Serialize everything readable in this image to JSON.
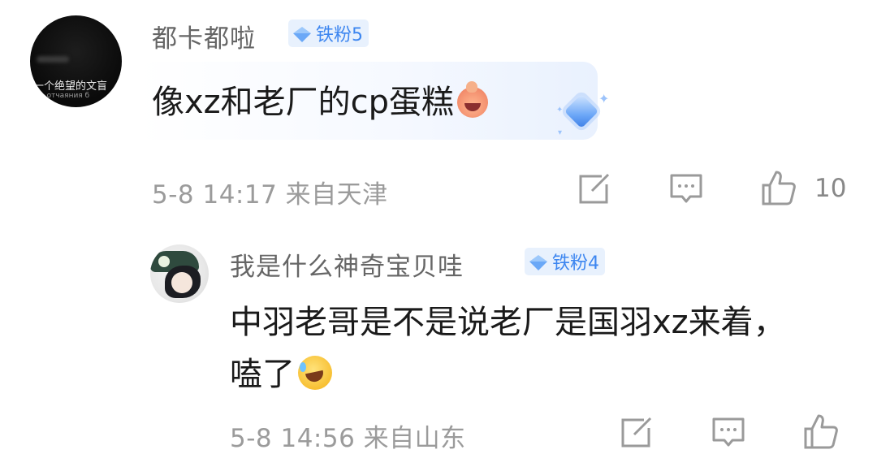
{
  "comment": {
    "author": "都卡都啦",
    "fan_badge": "铁粉5",
    "avatar_text_cn": "一个绝望的文盲",
    "avatar_text_ru": "до отчаяния б",
    "text": "像xz和老厂的cp蛋糕",
    "meta": "5-8 14:17  来自天津",
    "like_count": "10",
    "icons": [
      "edit-icon",
      "comment-icon",
      "thumb-up-icon"
    ]
  },
  "reply": {
    "author": "我是什么神奇宝贝哇",
    "fan_badge": "铁粉4",
    "text_line1": "中羽老哥是不是说老厂是国羽xz来着，",
    "text_line2": "嗑了",
    "meta": "5-8 14:56  来自山东",
    "icons": [
      "edit-icon",
      "comment-icon",
      "thumb-up-icon"
    ]
  },
  "colors": {
    "badge_bg": "#e8f1fd",
    "badge_text": "#3d86f0",
    "meta_text": "#9b9b9b",
    "name_text": "#666666"
  }
}
